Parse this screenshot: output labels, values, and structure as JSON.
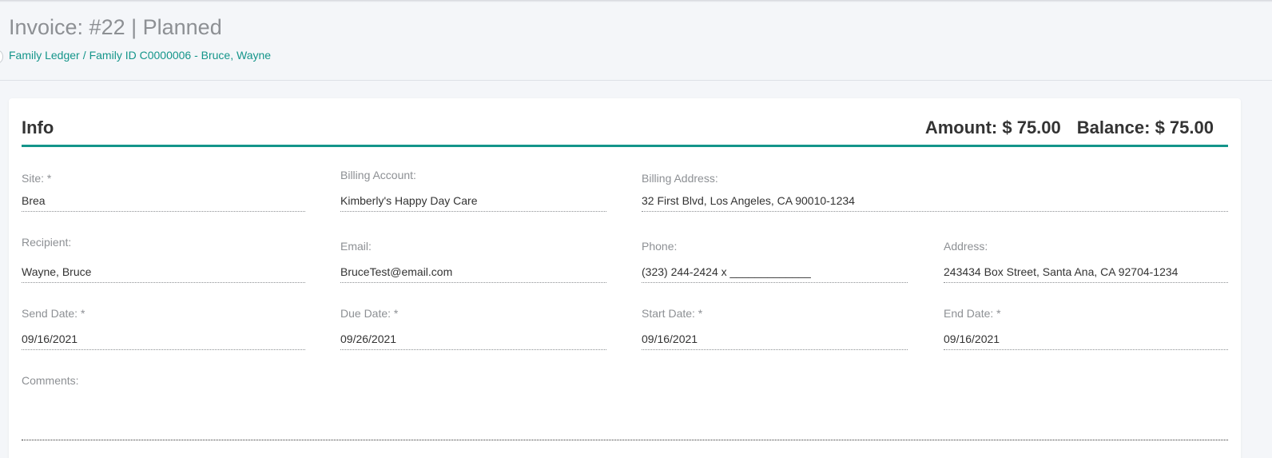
{
  "header": {
    "title": "Invoice: #22 | Planned",
    "breadcrumb": {
      "ledger": "Family Ledger",
      "separator": "/",
      "family": "Family ID C0000006 - Bruce, Wayne"
    }
  },
  "card": {
    "title": "Info",
    "amount": "Amount: $ 75.00",
    "balance": "Balance: $ 75.00"
  },
  "fields": {
    "site": {
      "label": "Site: *",
      "value": "Brea"
    },
    "billing_account": {
      "label": "Billing Account:",
      "value": "Kimberly's Happy Day Care"
    },
    "billing_address": {
      "label": "Billing Address:",
      "value": "32 First Blvd, Los Angeles, CA 90010-1234"
    },
    "recipient": {
      "label": "Recipient:",
      "value": "Wayne, Bruce"
    },
    "email": {
      "label": "Email:",
      "value": "BruceTest@email.com"
    },
    "phone": {
      "label": "Phone:",
      "value": "(323) 244-2424 x _____________"
    },
    "address": {
      "label": "Address:",
      "value": "243434 Box Street, Santa Ana, CA 92704-1234"
    },
    "send_date": {
      "label": "Send Date: *",
      "value": "09/16/2021"
    },
    "due_date": {
      "label": "Due Date: *",
      "value": "09/26/2021"
    },
    "start_date": {
      "label": "Start Date: *",
      "value": "09/16/2021"
    },
    "end_date": {
      "label": "End Date: *",
      "value": "09/16/2021"
    },
    "comments": {
      "label": "Comments:",
      "value": ""
    }
  },
  "colors": {
    "accent": "#14958a",
    "label": "#8d9094",
    "background": "#f4f6f9"
  }
}
